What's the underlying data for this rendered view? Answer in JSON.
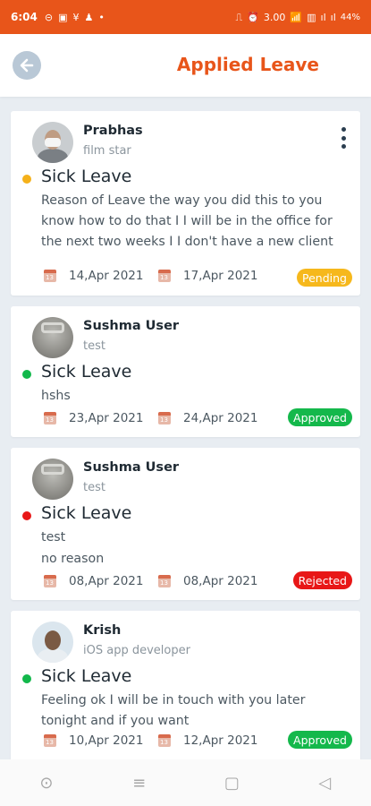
{
  "status_bar": {
    "time": "6:04",
    "battery": "44%",
    "left_icons": [
      "⊝",
      "▣",
      "¥",
      "♟",
      "•"
    ],
    "right_icons": [
      "⎍",
      "⏰",
      "3.00",
      "📶",
      "▥",
      "ıl",
      "ıl"
    ]
  },
  "header": {
    "title": "Applied Leave",
    "accent_color": "#e8551a"
  },
  "cards": [
    {
      "name": "Prabhas",
      "role": "film star",
      "leave_type": "Sick Leave",
      "dot_color": "#f5b11a",
      "reason": "Reason of Leave the way you did this to you know how to do that I I will be in the office for the next two weeks I I don't have a new client",
      "from": "14,Apr 2021",
      "to": "17,Apr 2021",
      "status": "Pending",
      "status_color": "#f6b81c"
    },
    {
      "name": "Sushma User",
      "role": "test",
      "leave_type": "Sick Leave",
      "dot_color": "#12b84b",
      "reason": "hshs",
      "from": "23,Apr 2021",
      "to": "24,Apr 2021",
      "status": "Approved",
      "status_color": "#14b84b"
    },
    {
      "name": "Sushma User",
      "role": "test",
      "leave_type": "Sick Leave",
      "dot_color": "#e81717",
      "reason": "test",
      "reason_line2": "no reason",
      "from": "08,Apr 2021",
      "to": "08,Apr 2021",
      "status": "Rejected",
      "status_color": "#e81717"
    },
    {
      "name": "Krish",
      "role": "iOS app developer",
      "leave_type": "Sick Leave",
      "dot_color": "#12b84b",
      "reason": "Feeling ok I will be in touch with you later tonight and if you want",
      "from": "10,Apr 2021",
      "to": "12,Apr 2021",
      "status": "Approved",
      "status_color": "#14b84b"
    }
  ],
  "nav": {
    "icons": [
      "⊙",
      "≡",
      "▢",
      "◁"
    ]
  }
}
